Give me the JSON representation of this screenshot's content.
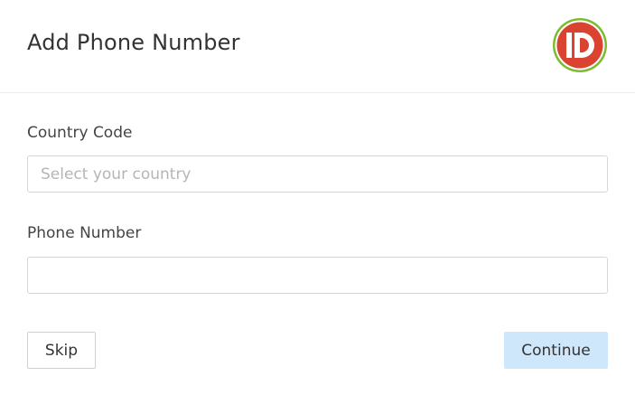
{
  "dialog": {
    "title": "Add Phone Number",
    "logo_icon": "id-logo-icon",
    "logo_text": "ID",
    "colors": {
      "logo_red": "#d9432f",
      "logo_ring": "#7dbb2e",
      "continue_bg": "#cfe7fb",
      "border": "#d6d6d6"
    }
  },
  "form": {
    "country_code": {
      "label": "Country Code",
      "placeholder": "Select your country",
      "value": ""
    },
    "phone_number": {
      "label": "Phone Number",
      "placeholder": "",
      "value": ""
    }
  },
  "actions": {
    "skip_label": "Skip",
    "continue_label": "Continue"
  }
}
